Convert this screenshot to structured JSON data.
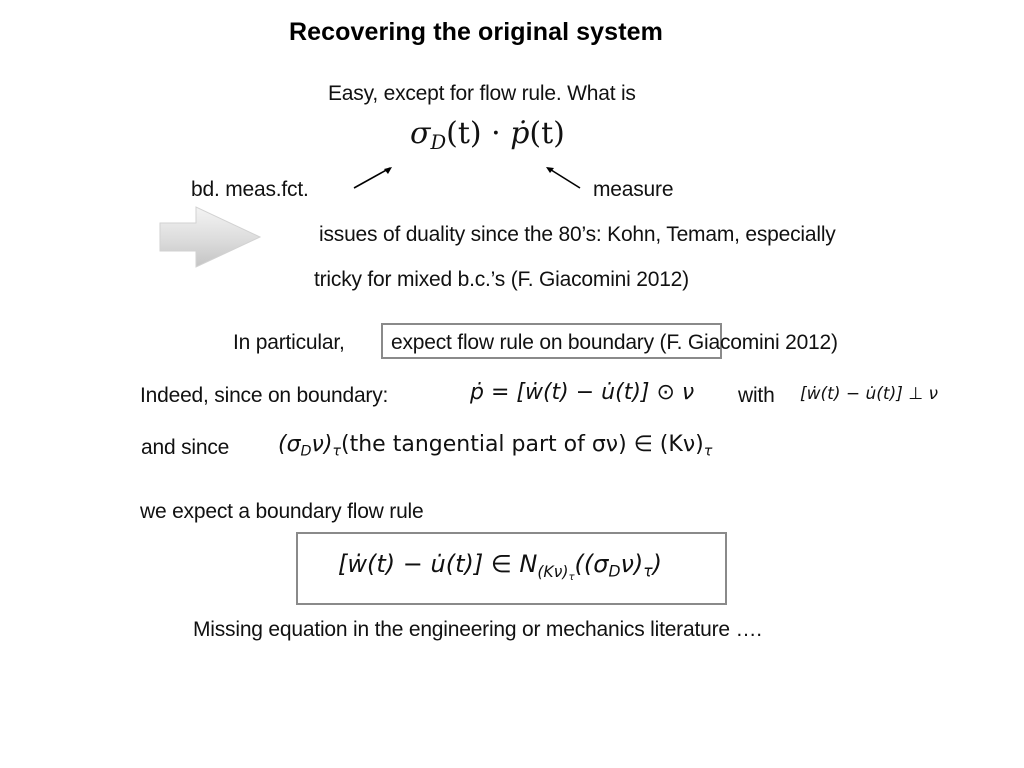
{
  "slide": {
    "title": "Recovering the original system",
    "intro": "Easy, except for flow rule. What is",
    "main_formula": {
      "sigma": "σ",
      "sub_D": "D",
      "t_part": "(t) · ",
      "p_dot": "ṗ",
      "t_end": "(t)"
    },
    "label_left": "bd. meas.fct.",
    "label_right": "measure",
    "duality_line1": "issues of duality since the 80’s: Kohn, Temam, especially",
    "duality_line2": "tricky for mixed b.c.’s (F. Giacomini 2012)",
    "particular_label": "In particular,",
    "particular_text": "expect flow rule on boundary (F. Giacomini 2012)",
    "indeed_label": "Indeed, since on boundary:",
    "indeed_formula": "ṗ = [ẇ(t) − u̇(t)] ⊙ ν",
    "with_label": "with",
    "with_formula": "[ẇ(t) − u̇(t)] ⊥ ν",
    "and_since_label": "and since",
    "and_since_formula": {
      "lhs_open": "(σ",
      "lhs_sub": "D",
      "lhs_close": "ν)",
      "lhs_tau": "τ",
      "middle": "(the tangential part of σν) ∈ (Kν)",
      "rhs_tau": "τ"
    },
    "expect_label": "we expect a boundary flow rule",
    "boxed_formula": {
      "lhs": "[ẇ(t) − u̇(t)] ∈ N",
      "n_sub": "(Kν)",
      "n_sub_tau": "τ",
      "arg_open": "((σ",
      "arg_sub": "D",
      "arg_mid": "ν)",
      "arg_tau": "τ",
      "arg_close": ")"
    },
    "conclusion": "Missing equation in the engineering or mechanics literature …."
  }
}
